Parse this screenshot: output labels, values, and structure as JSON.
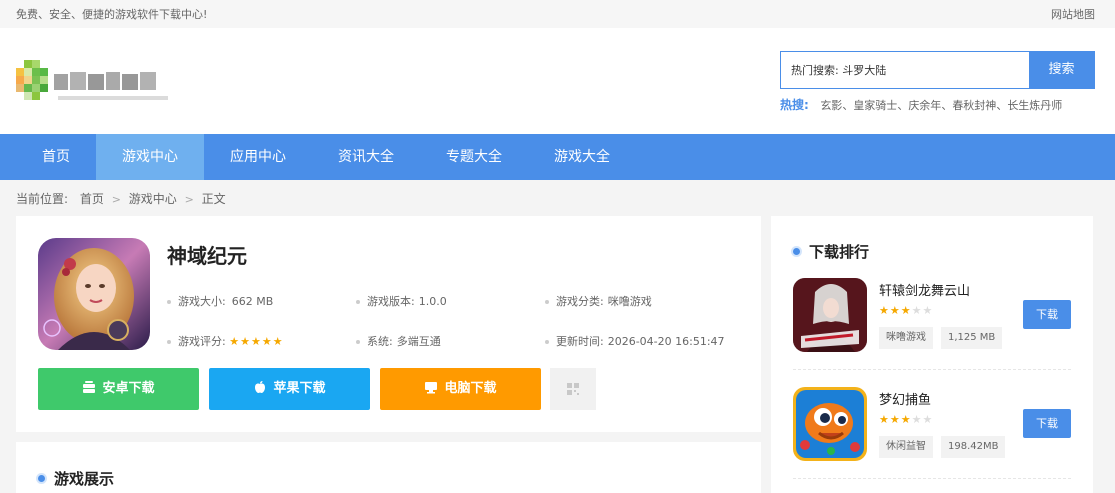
{
  "topbar": {
    "tagline": "免费、安全、便捷的游戏软件下载中心!",
    "sitemap": "网站地图"
  },
  "search": {
    "value": "热门搜索: 斗罗大陆",
    "button": "搜索",
    "hot_label": "热搜:",
    "hot_terms": [
      "玄影",
      "皇家骑士",
      "庆余年",
      "春秋封神",
      "长生炼丹师"
    ]
  },
  "nav": [
    "首页",
    "游戏中心",
    "应用中心",
    "资讯大全",
    "专题大全",
    "游戏大全"
  ],
  "breadcrumb": {
    "label": "当前位置:",
    "items": [
      "首页",
      "游戏中心",
      "正文"
    ]
  },
  "app": {
    "title": "神域纪元",
    "size_label": "游戏大小:",
    "size": "662 MB",
    "version_label": "游戏版本:",
    "version": "1.0.0",
    "category_label": "游戏分类:",
    "category": "咪噜游戏",
    "rating_label": "游戏评分:",
    "rating": 5,
    "system_label": "系统:",
    "system": "多端互通",
    "updated_label": "更新时间:",
    "updated": "2026-04-20 16:51:47",
    "buttons": {
      "android": "安卓下载",
      "ios": "苹果下载",
      "pc": "电脑下载"
    }
  },
  "showcase": {
    "title": "游戏展示"
  },
  "ranking": {
    "title": "下载排行",
    "items": [
      {
        "name": "轩辕剑龙舞云山",
        "rating": 3,
        "category": "咪噜游戏",
        "size": "1,125 MB",
        "button": "下载"
      },
      {
        "name": "梦幻捕鱼",
        "rating": 3,
        "category": "休闲益智",
        "size": "198.42MB",
        "button": "下载"
      }
    ]
  },
  "colors": {
    "primary": "#4a8ee8",
    "nav_active": "#6fb0ef",
    "android": "#3fc96b",
    "ios": "#1aa7f2",
    "pc": "#ff9a00",
    "star": "#f5a800"
  }
}
